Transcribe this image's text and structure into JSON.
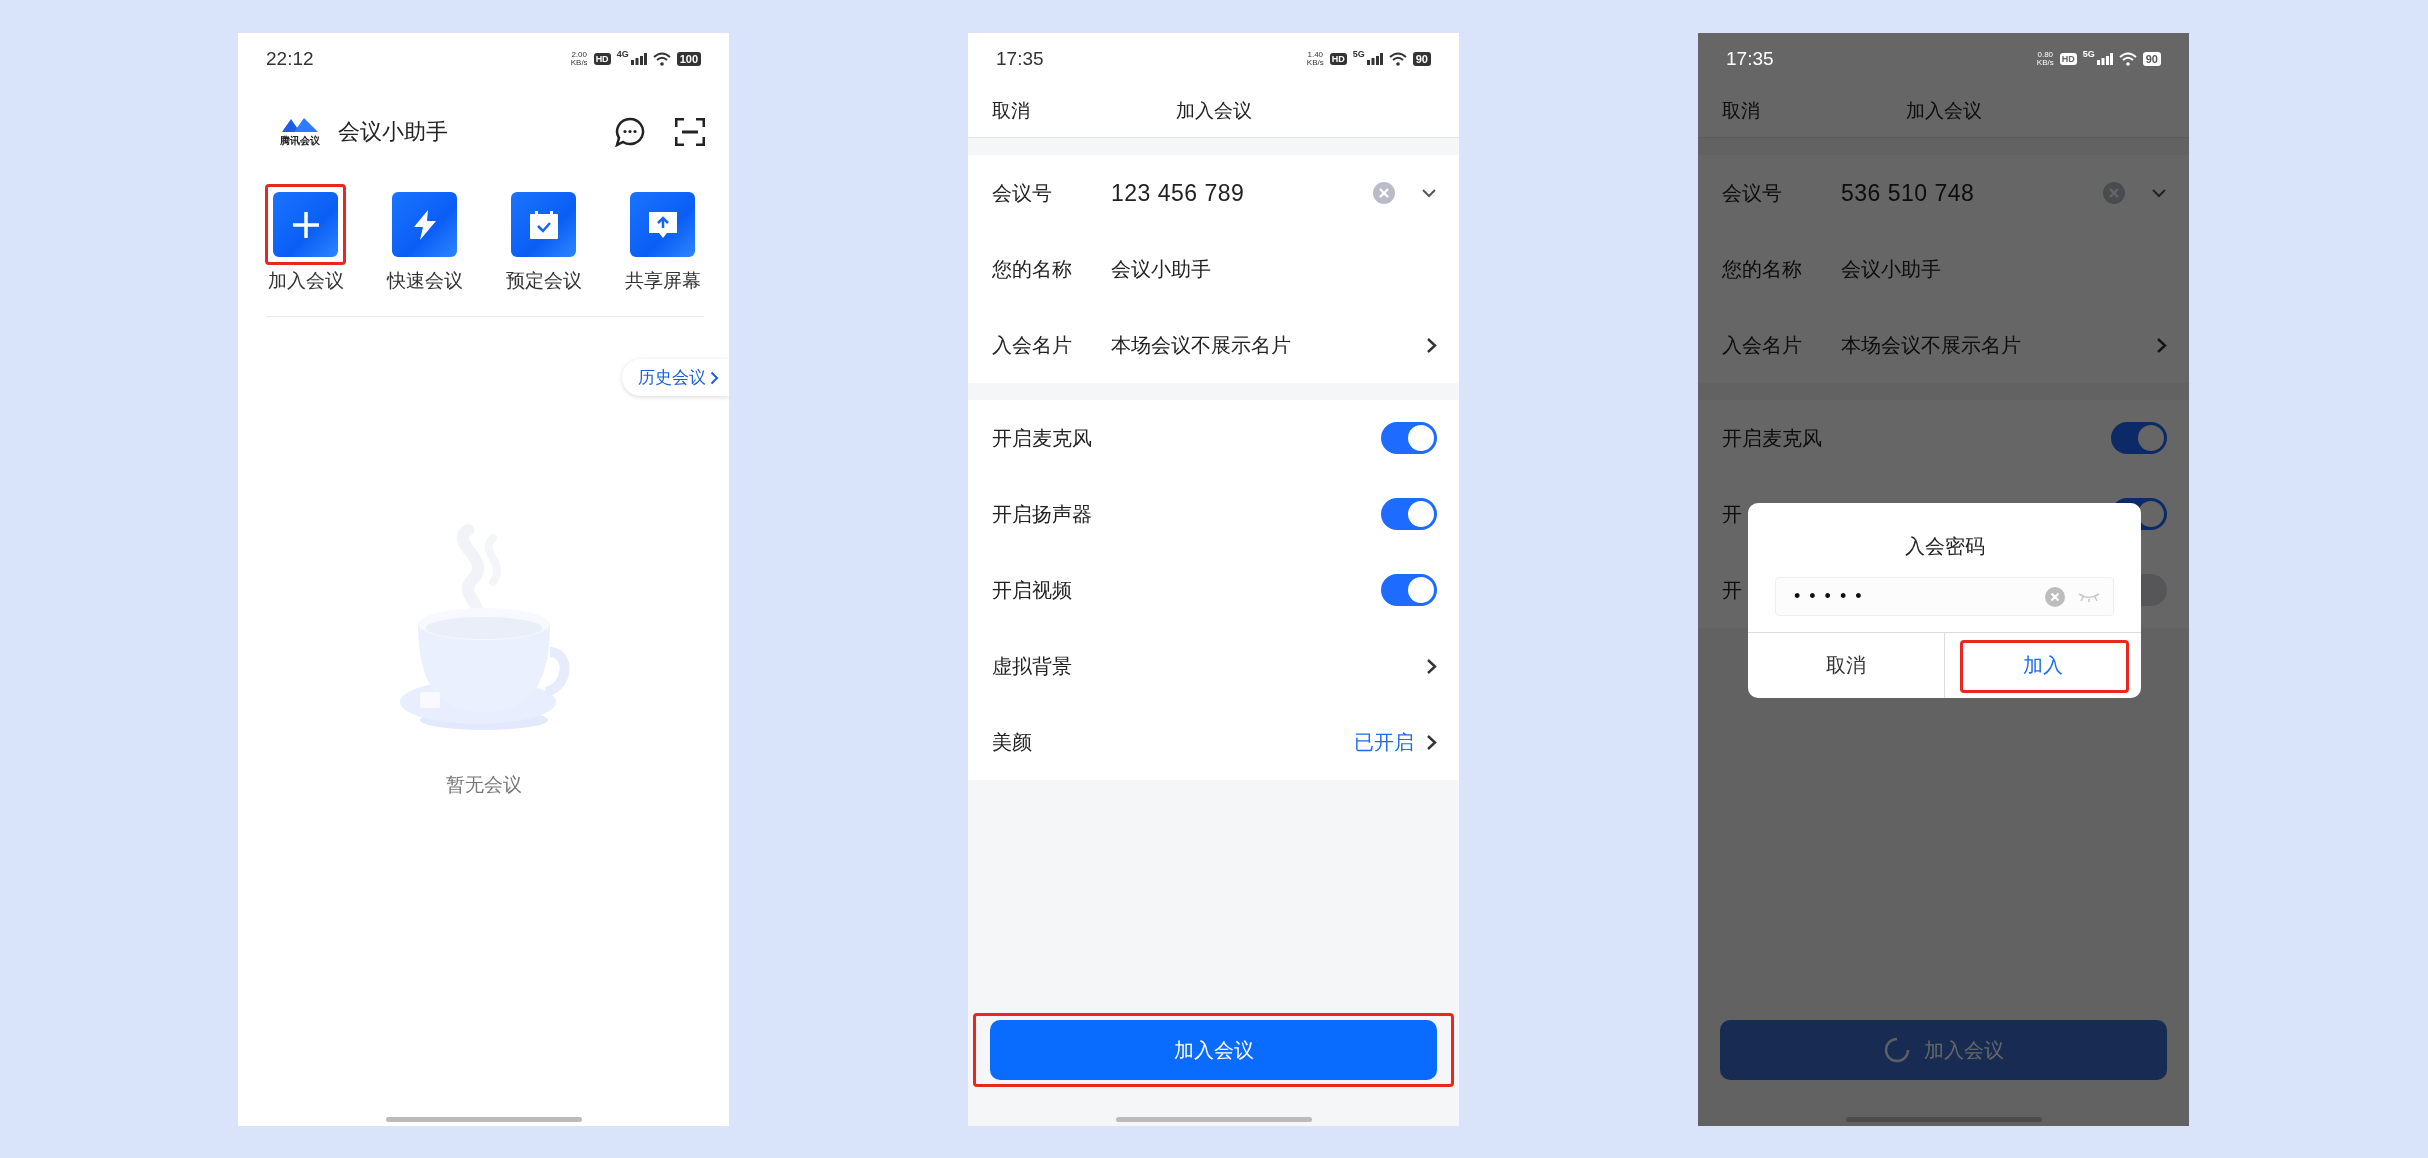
{
  "screens": [
    {
      "kind": "home",
      "status_bar": {
        "time": "22:12",
        "speed": "2.00",
        "speed_unit": "KB/s",
        "hd": "HD",
        "network": "4G",
        "battery": "100"
      },
      "logo_text": "腾讯会议",
      "app_title": "会议小助手",
      "actions": [
        {
          "label": "加入会议",
          "highlighted": true
        },
        {
          "label": "快速会议",
          "highlighted": false
        },
        {
          "label": "预定会议",
          "highlighted": false
        },
        {
          "label": "共享屏幕",
          "highlighted": false
        }
      ],
      "history_button": "历史会议",
      "empty_text": "暂无会议"
    },
    {
      "kind": "form",
      "status_bar": {
        "time": "17:35",
        "speed": "1.40",
        "speed_unit": "KB/s",
        "hd": "HD",
        "network": "5G",
        "battery": "90"
      },
      "nav": {
        "cancel": "取消",
        "title": "加入会议"
      },
      "sections": [
        {
          "rows": [
            {
              "kind": "input",
              "label": "会议号",
              "value": "123 456 789"
            },
            {
              "kind": "text",
              "label": "您的名称",
              "value": "会议小助手"
            },
            {
              "kind": "link",
              "label": "入会名片",
              "value": "本场会议不展示名片"
            }
          ]
        },
        {
          "rows": [
            {
              "kind": "toggle",
              "label": "开启麦克风",
              "on": true
            },
            {
              "kind": "toggle",
              "label": "开启扬声器",
              "on": true
            },
            {
              "kind": "toggle",
              "label": "开启视频",
              "on": true
            },
            {
              "kind": "setting",
              "label": "虚拟背景"
            },
            {
              "kind": "setting",
              "label": "美颜",
              "value": "已开启"
            }
          ]
        }
      ],
      "join_button": {
        "label": "加入会议",
        "highlighted": true,
        "loading": false
      }
    },
    {
      "kind": "form",
      "status_bar": {
        "time": "17:35",
        "speed": "0.80",
        "speed_unit": "KB/s",
        "hd": "HD",
        "network": "5G",
        "battery": "90"
      },
      "nav": {
        "cancel": "取消",
        "title": "加入会议"
      },
      "sections": [
        {
          "rows": [
            {
              "kind": "input",
              "label": "会议号",
              "value": "536 510 748"
            },
            {
              "kind": "text",
              "label": "您的名称",
              "value": "会议小助手"
            },
            {
              "kind": "link",
              "label": "入会名片",
              "value": "本场会议不展示名片"
            }
          ]
        },
        {
          "rows": [
            {
              "kind": "toggle",
              "label": "开启麦克风",
              "on": true
            },
            {
              "kind": "toggle",
              "label": "开",
              "on": true
            },
            {
              "kind": "toggle",
              "label": "开",
              "on": false
            }
          ]
        }
      ],
      "join_button": {
        "label": "加入会议",
        "highlighted": false,
        "loading": true
      },
      "dialog": {
        "title": "入会密码",
        "password": "•••••",
        "cancel": "取消",
        "confirm": {
          "label": "加入",
          "highlighted": true
        }
      }
    }
  ]
}
